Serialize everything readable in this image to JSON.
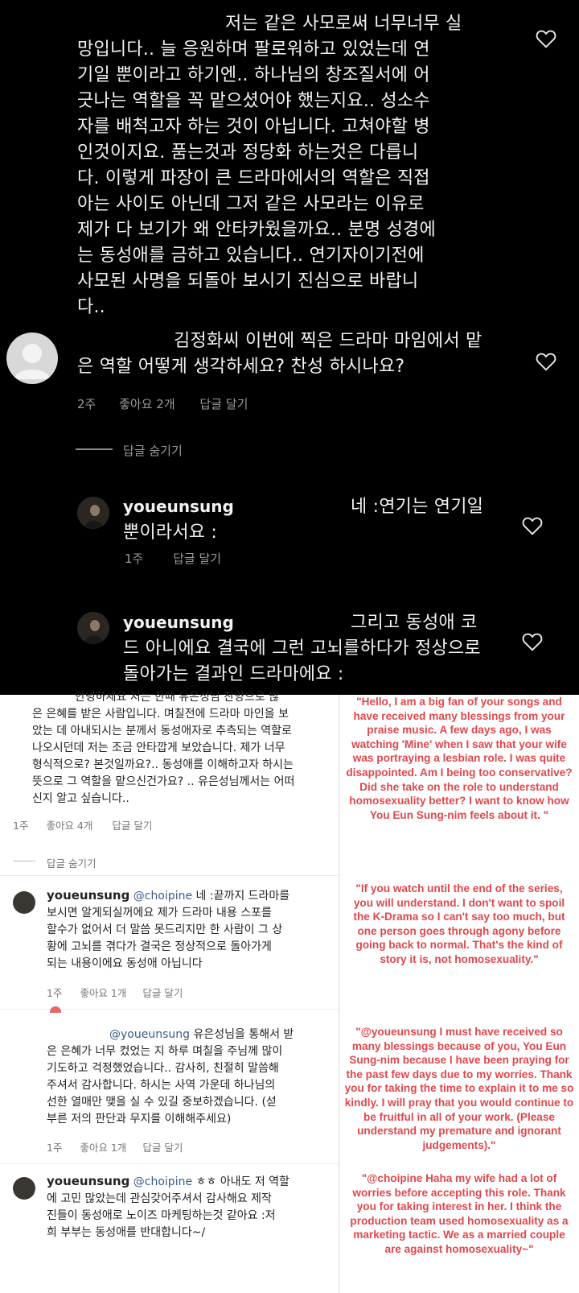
{
  "dark": {
    "post": {
      "lines": [
        "저는 같은 사모로써 너무너무 실",
        "망입니다.. 늘 응원하며 팔로워하고 있었는데 연",
        "기일 뿐이라고 하기엔.. 하나님의 창조질서에 어",
        "긋나는 역할을 꼭 맡으셨어야 했는지요.. 성소수",
        "자를 배척고자 하는 것이 아닙니다. 고쳐야할 병",
        "인것이지요. 품는것과 정당화 하는것은 다릅니",
        "다. 이렇게 파장이 큰 드라마에서의 역할은 직접",
        "아는 사이도 아닌데 그저 같은 사모라는 이유로",
        "제가 다 보기가 왜 안타카웠을까요.. 분명 성경에",
        "는 동성애를 금하고 있습니다.. 연기자이기전에",
        "사모된 사명을 되돌아 보시기 진심으로 바랍니",
        "다.."
      ]
    },
    "comment1": {
      "lines": [
        "김정화씨 이번에 찍은 드라마 마임에서 맡",
        "은 역할 어떻게 생각하세요? 찬성 하시나요?"
      ],
      "time": "2주",
      "likes": "좋아요 2개",
      "reply": "답글 달기"
    },
    "hide_replies": "답글 숨기기",
    "reply1": {
      "username": "youeunsung",
      "lines": [
        "네 :연기는 연기일",
        "뿐이라서요 :"
      ],
      "time": "1주",
      "reply": "답글 달기"
    },
    "reply2": {
      "username": "youeunsung",
      "lines": [
        "그리고 동성애 코",
        "드 아니에요 결국에 그런 고뇌를하다가 정상으로",
        "돌아가는 결과인 드라마에요 :"
      ]
    }
  },
  "light": {
    "c1": {
      "lines": [
        "안녕하세요 저는 한때 유은성님 찬양으로 많",
        "은 은혜를 받은 사람입니다. 며칠전에 드라마 마인을 보",
        "았는 데 아내되시는 분께서 동성애자로 추측되는 역할로",
        "나오시던데 저는 조금 안타깝게 보았습니다. 제가 너무",
        "형식적으로? 본것일까요?.. 동성애를 이해하고자 하시는",
        "뜻으로 그 역할을 맡으신건가요? .. 유은성님께서는 어떠",
        "신지 알고 싶습니다.."
      ],
      "time": "1주",
      "likes": "좋아요 4개",
      "reply": "답글 달기"
    },
    "hide_replies": "답글 숨기기",
    "c2": {
      "username": "youeunsung",
      "mention": "@choipine",
      "first": "네 :끝까지 드라마를",
      "lines": [
        "보시면 알게되실꺼에요 제가 드라마 내용 스포를",
        "할수가 없어서 더 말씀 못드리지만 한 사람이 그 상",
        "황에 고뇌를 겪다가 결국은 정상적으로 돌아가게",
        "되는 내용이에요 동성애 아닙니다"
      ],
      "time": "1주",
      "likes": "좋아요 1개",
      "reply": "답글 달기"
    },
    "c3": {
      "mention": "@youeunsung",
      "first": "유은성님을 통해서 받",
      "lines": [
        "은 은혜가 너무 컸었는 지 하루 며칠을 주님께 많이",
        "기도하고 걱정했었습니다.. 감사히, 친절히 말씀해",
        "주셔서 감사합니다. 하시는 사역 가운데 하나님의",
        "선한 열매만 맺을 실 수 있길 중보하겠습니다. (섣",
        "부른 저의 판단과 무지를 이해해주세요)"
      ],
      "time": "1주",
      "likes": "좋아요 1개",
      "reply": "답글 달기"
    },
    "c4": {
      "username": "youeunsung",
      "mention": "@choipine",
      "first": "ㅎㅎ 아내도 저 역할",
      "lines": [
        "에 고민 많았는데 관심갖어주셔서 감사해요 제작",
        "진들이 동성애로 노이즈 마케팅하는것 같아요 :저",
        "희 부부는 동성애를 반대합니다~/"
      ]
    },
    "translations": [
      "\"Hello, I am a big fan of your songs and have received many blessings from your praise music. A few days ago, I was watching 'Mine' when I saw that your wife was portraying a lesbian role. I was quite disappointed. Am I being too conservative? Did she take on the role to understand homosexuality better? I want to know how You Eun Sung-nim feels about it. \"",
      "\"If you watch until the end of the series, you will understand. I don't want to spoil the K-Drama so I can't say too much, but one person goes through agony before going back to normal. That's the kind of story it is, not homosexuality.\"",
      "\"@youeunsung I must have received so many blessings because of you, You Eun Sung-nim because I have been praying for the past few days due to my worries. Thank you for taking the time to explain it to me so kindly. I will pray that you would continue to be fruitful in all of your work. (Please understand my premature and ignorant judgements).\"",
      "\"@choipine Haha my wife had a lot of worries before accepting this role. Thank you for taking interest in her. I think the production team used homosexuality as a marketing tactic. We as a married couple are against homosexuality~\""
    ]
  }
}
